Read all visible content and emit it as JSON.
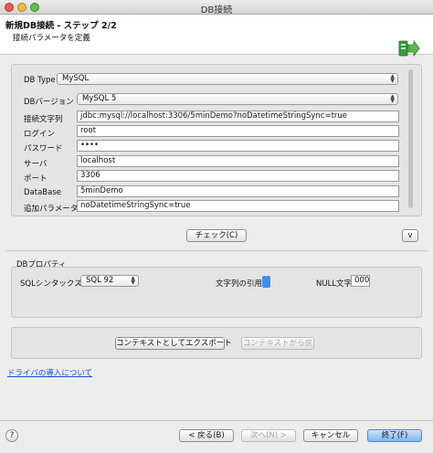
{
  "window": {
    "title": "DB接続"
  },
  "header": {
    "title": "新規DB接続 - ステップ 2/2",
    "subtitle": "接続パラメータを定義"
  },
  "connection": {
    "db_type": {
      "label": "DB Type",
      "value": "MySQL"
    },
    "db_version": {
      "label": "DBバージョン",
      "value": "MySQL 5"
    },
    "connection_string": {
      "label": "接続文字列",
      "value": "jdbc:mysql://localhost:3306/5minDemo?noDatetimeStringSync=true"
    },
    "login": {
      "label": "ログイン",
      "value": "root"
    },
    "password": {
      "label": "パスワード",
      "value": "••••"
    },
    "server": {
      "label": "サーバ",
      "value": "localhost"
    },
    "port": {
      "label": "ポート",
      "value": "3306"
    },
    "database": {
      "label": "DataBase",
      "value": "5minDemo"
    },
    "additional_params": {
      "label": "追加パラメータ",
      "value": "noDatetimeStringSync=true"
    }
  },
  "check_button": "チェック(C)",
  "toggle_button": "v",
  "db_properties": {
    "title": "DBプロパティ",
    "sql_syntax": {
      "label": "SQLシンタックス",
      "value": "SQL 92"
    },
    "string_quote": {
      "label": "文字列の引用",
      "value": "'"
    },
    "null_char": {
      "label": "NULL文字",
      "value": "000"
    }
  },
  "context": {
    "export_button": "コンテキストとしてエクスポート",
    "revert_button": "コンテキストから戻"
  },
  "driver_link": "ドライバの導入について",
  "footer": {
    "help": "?",
    "back": "< 戻る(B)",
    "next": "次へ(N) >",
    "cancel": "キャンセル",
    "finish": "終了(F)"
  }
}
